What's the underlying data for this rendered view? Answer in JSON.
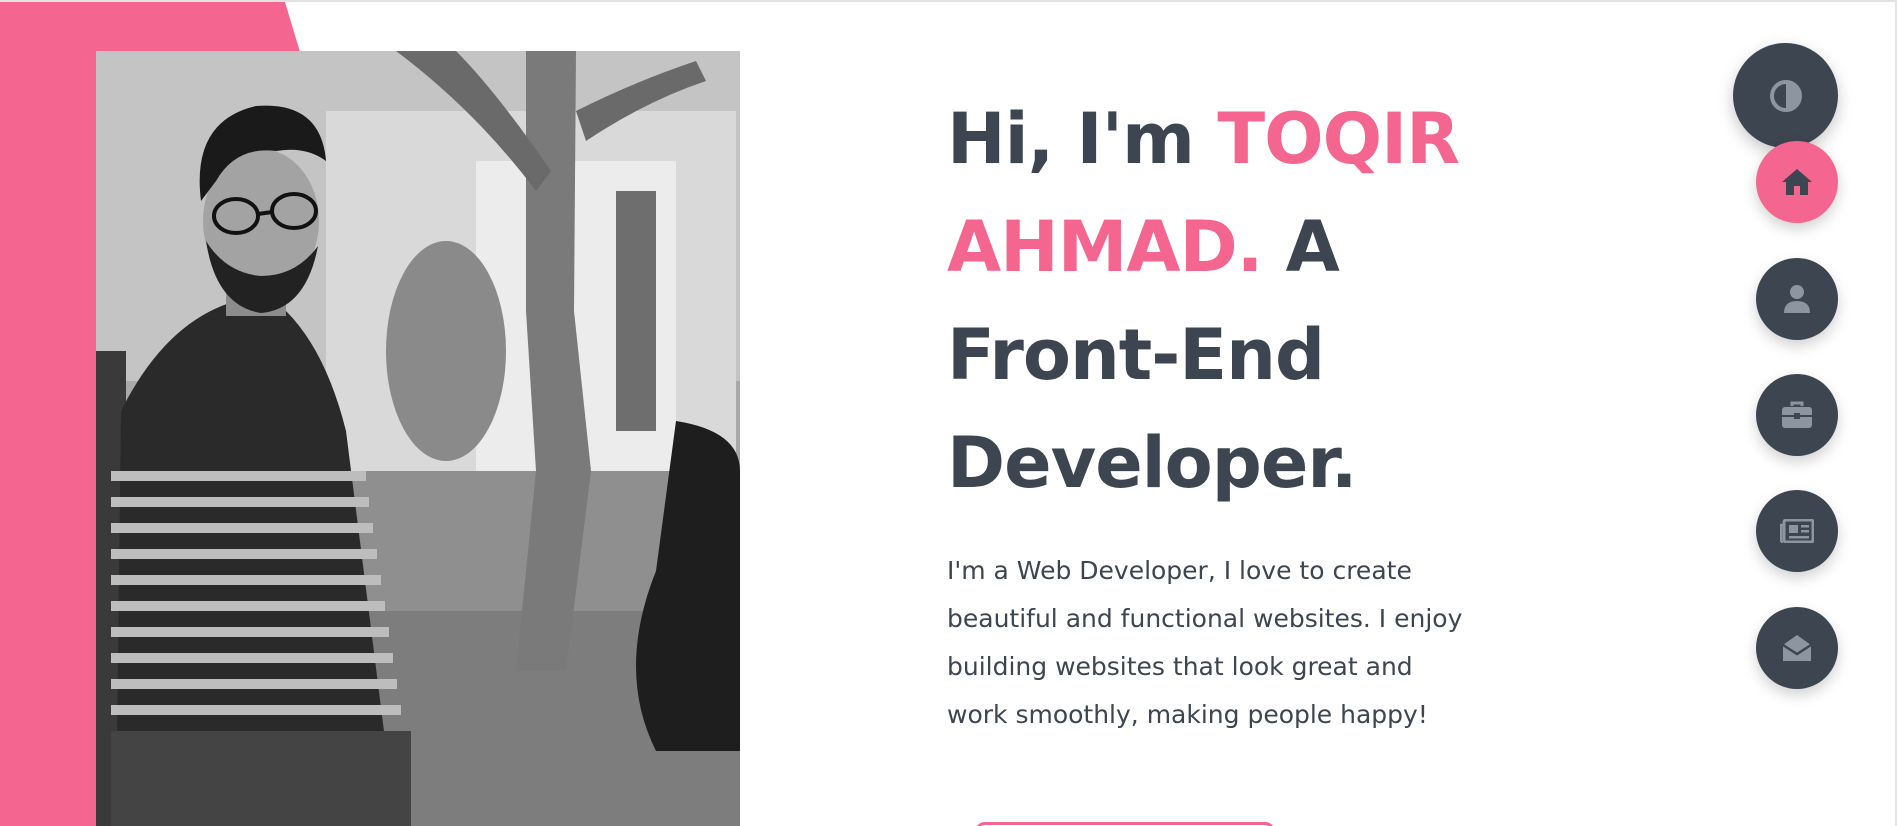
{
  "hero": {
    "line1_prefix": "Hi, I'm ",
    "name_first": "TOQIR",
    "name_last": "AHMAD.",
    "line2_suffix": " A",
    "line3": "Front-End",
    "line4": "Developer.",
    "intro": "I'm a Web Developer, I love to create beautiful and functional websites. I enjoy building websites that look great and work smoothly, making people happy!"
  },
  "nav": {
    "theme_icon": "contrast-icon",
    "items": [
      {
        "icon": "home-icon",
        "active": true
      },
      {
        "icon": "user-icon",
        "active": false
      },
      {
        "icon": "briefcase-icon",
        "active": false
      },
      {
        "icon": "newspaper-icon",
        "active": false
      },
      {
        "icon": "envelope-open-icon",
        "active": false
      }
    ]
  },
  "colors": {
    "accent": "#f4668f",
    "dark": "#3c4550",
    "icon_muted": "#8d95a0",
    "background": "#ffffff"
  }
}
